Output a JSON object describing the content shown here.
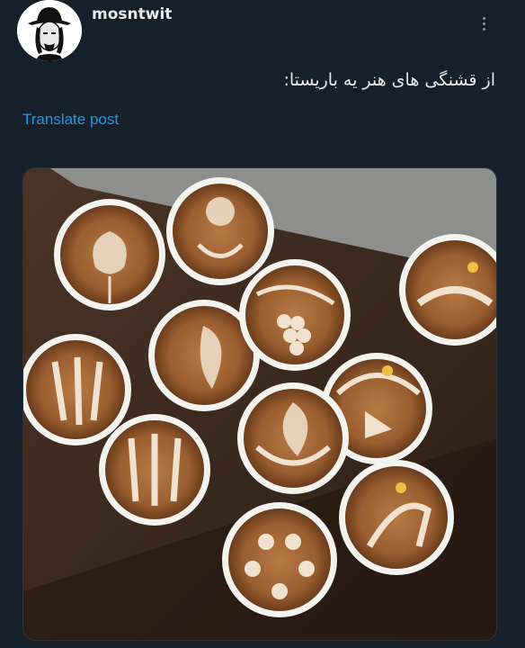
{
  "post": {
    "username": "mosntwit",
    "text": "از قشنگی های هنر یه باریستا:",
    "translate_label": "Translate post",
    "avatar_icon": "portrait-avatar-icon",
    "more_icon": "more-options-icon"
  },
  "media": {
    "kind": "photo",
    "subject": "latte art cups"
  }
}
